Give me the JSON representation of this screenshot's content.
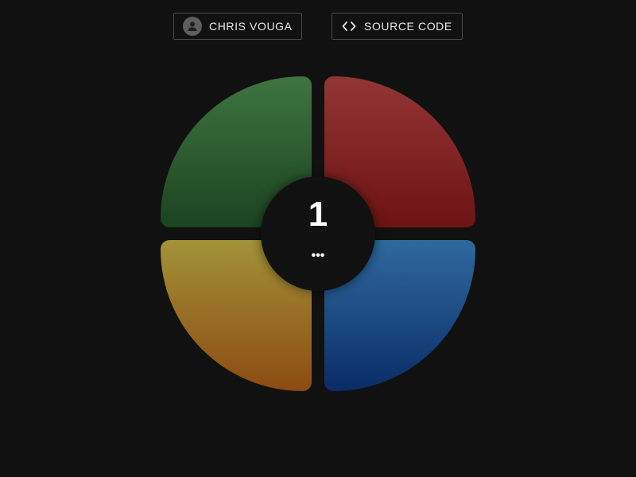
{
  "header": {
    "author_label": "CHRIS VOUGA",
    "author_icon": "person-icon",
    "source_label": "SOURCE CODE",
    "source_icon": "code-icon"
  },
  "game": {
    "score": "1",
    "status": "•••",
    "pads": [
      {
        "name": "green",
        "color_top": "#3e7440",
        "color_bottom": "#1b4420"
      },
      {
        "name": "red",
        "color_top": "#913535",
        "color_bottom": "#6e1313"
      },
      {
        "name": "yellow",
        "color_top": "#a39338",
        "color_bottom": "#8c4a12"
      },
      {
        "name": "blue",
        "color_top": "#2e6a9e",
        "color_bottom": "#0b2c66"
      }
    ]
  },
  "colors": {
    "background": "#111111",
    "button_border": "#4a4a4a",
    "text": "#e8e8e8"
  }
}
